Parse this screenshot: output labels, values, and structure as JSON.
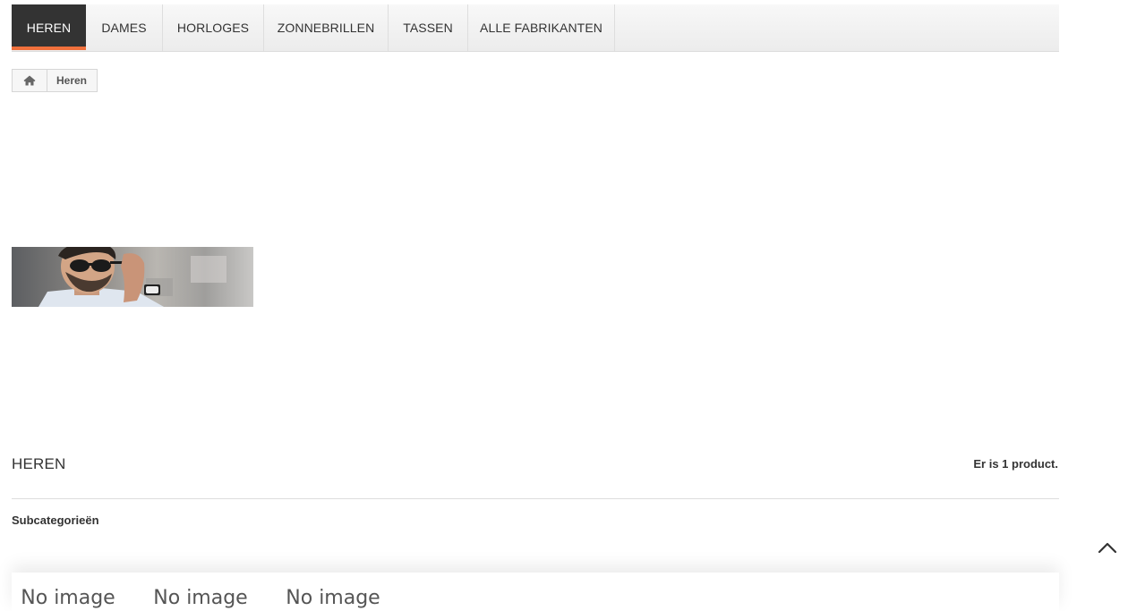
{
  "nav": {
    "items": [
      {
        "label": "HEREN",
        "active": true
      },
      {
        "label": "DAMES",
        "active": false
      },
      {
        "label": "HORLOGES",
        "active": false
      },
      {
        "label": "ZONNEBRILLEN",
        "active": false
      },
      {
        "label": "TASSEN",
        "active": false
      },
      {
        "label": "ALLE FABRIKANTEN",
        "active": false
      }
    ],
    "accent_color": "#f0703c",
    "active_bg": "#333333"
  },
  "breadcrumb": {
    "home_icon": "home-icon",
    "current": "Heren"
  },
  "banner": {
    "image": "man-with-sunglasses-photo"
  },
  "category": {
    "title": "HEREN",
    "product_count": "Er is 1 product.",
    "subcategories_label": "Subcategorieën",
    "subcategories": [
      {
        "image_text": "No image"
      },
      {
        "image_text": "No image"
      },
      {
        "image_text": "No image"
      }
    ]
  },
  "back_to_top_icon": "chevron-up-icon"
}
